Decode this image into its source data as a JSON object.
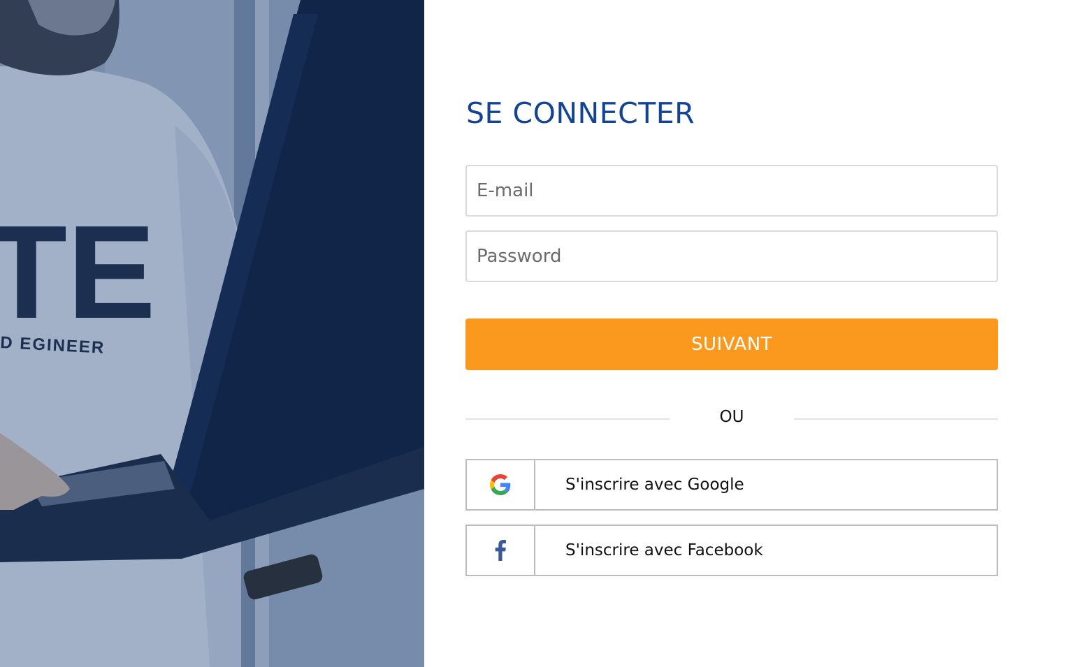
{
  "login": {
    "title": "SE CONNECTER",
    "email_placeholder": "E-mail",
    "password_placeholder": "Password",
    "submit_label": "SUIVANT",
    "divider_label": "OU",
    "google_label": "S'inscrire avec Google",
    "facebook_label": "S'inscrire avec Facebook"
  },
  "hero": {
    "shirt_big_letters": "TE",
    "shirt_text": "D EGINEER"
  },
  "colors": {
    "title": "#134493",
    "primary_button": "#fb991f",
    "facebook": "#3b5998",
    "hero_overlay": "#1c3c6e"
  },
  "icons": {
    "google": "google-icon",
    "facebook": "facebook-icon"
  }
}
